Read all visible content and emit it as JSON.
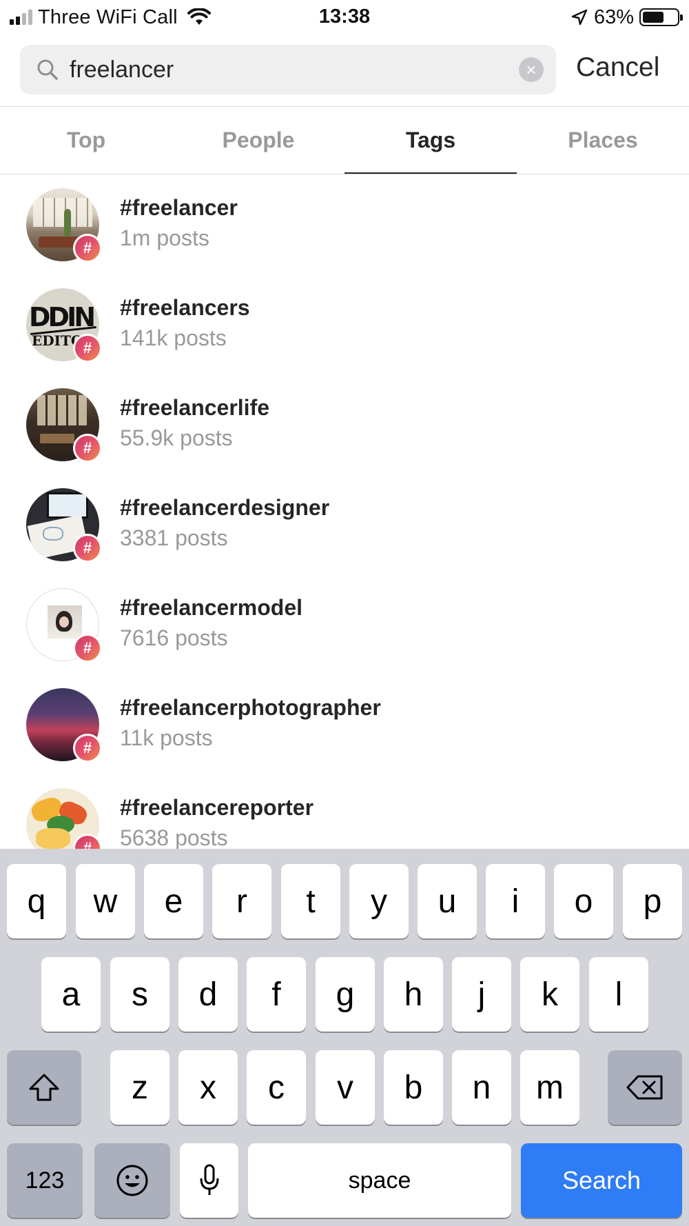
{
  "status_bar": {
    "carrier": "Three WiFi Call",
    "time": "13:38",
    "battery": "63%",
    "battery_level": 0.63
  },
  "search": {
    "value": "freelancer",
    "placeholder": "Search",
    "cancel_label": "Cancel"
  },
  "tabs": [
    {
      "label": "Top",
      "active": false
    },
    {
      "label": "People",
      "active": false
    },
    {
      "label": "Tags",
      "active": true
    },
    {
      "label": "Places",
      "active": false
    }
  ],
  "results": [
    {
      "tag": "#freelancer",
      "count": "1m posts"
    },
    {
      "tag": "#freelancers",
      "count": "141k posts"
    },
    {
      "tag": "#freelancerlife",
      "count": "55.9k posts"
    },
    {
      "tag": "#freelancerdesigner",
      "count": "3381 posts"
    },
    {
      "tag": "#freelancermodel",
      "count": "7616 posts"
    },
    {
      "tag": "#freelancerphotographer",
      "count": "11k posts"
    },
    {
      "tag": "#freelancereporter",
      "count": "5638 posts"
    }
  ],
  "keyboard": {
    "row1": [
      "q",
      "w",
      "e",
      "r",
      "t",
      "y",
      "u",
      "i",
      "o",
      "p"
    ],
    "row2": [
      "a",
      "s",
      "d",
      "f",
      "g",
      "h",
      "j",
      "k",
      "l"
    ],
    "row3": [
      "z",
      "x",
      "c",
      "v",
      "b",
      "n",
      "m"
    ],
    "numbers_label": "123",
    "space_label": "space",
    "search_label": "Search"
  },
  "colors": {
    "accent_blue": "#2e7cf6",
    "hashtag_badge": "#e2546b",
    "secondary_text": "#999999"
  }
}
